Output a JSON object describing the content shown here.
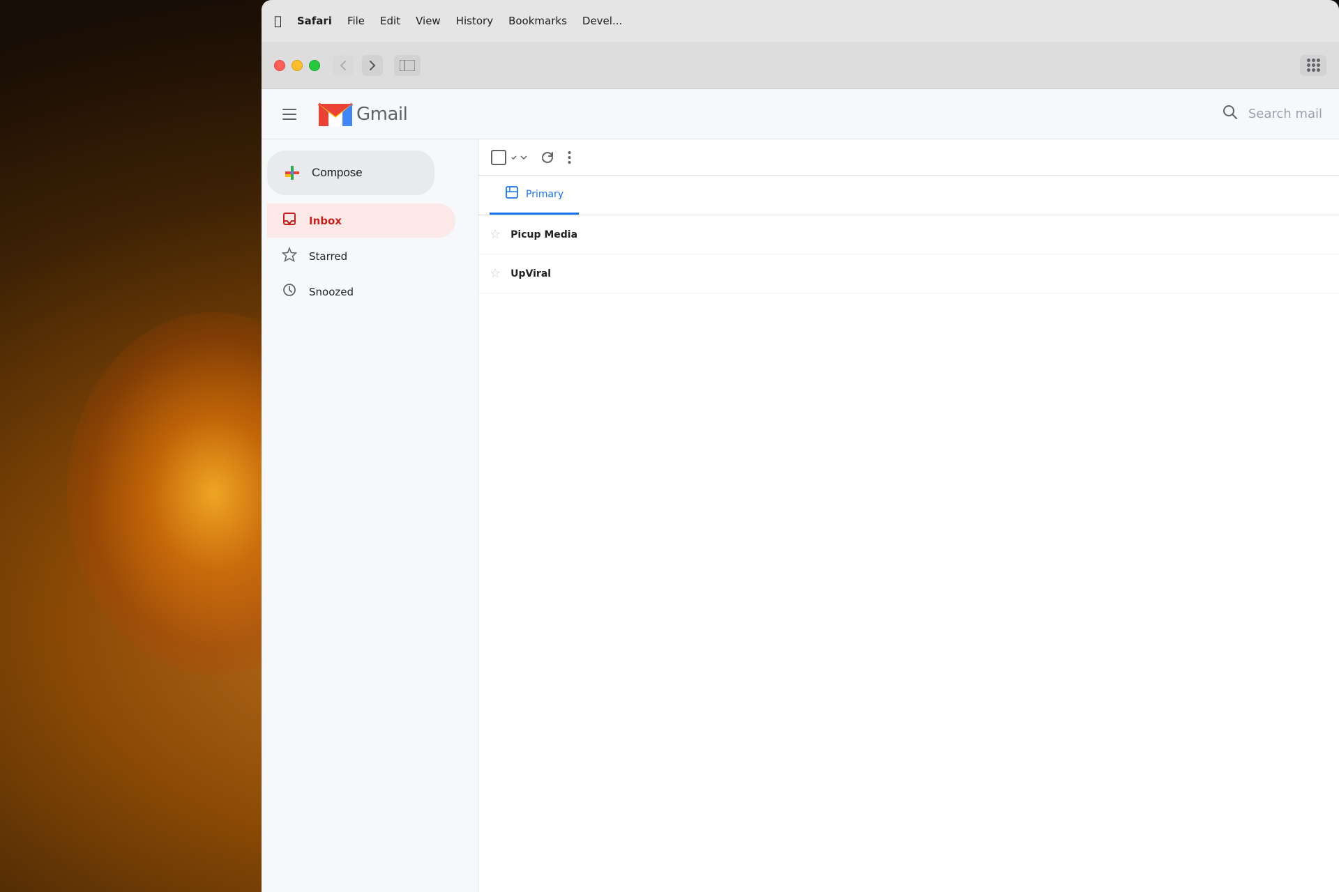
{
  "background": {
    "color": "#1a1008"
  },
  "menubar": {
    "apple_icon": "🍎",
    "items": [
      {
        "label": "Safari",
        "bold": true
      },
      {
        "label": "File",
        "bold": false
      },
      {
        "label": "Edit",
        "bold": false
      },
      {
        "label": "View",
        "bold": false
      },
      {
        "label": "History",
        "bold": false
      },
      {
        "label": "Bookmarks",
        "bold": false
      },
      {
        "label": "Devel...",
        "bold": false
      }
    ]
  },
  "browser": {
    "back_btn": "‹",
    "forward_btn": "›",
    "sidebar_icon": "⊟"
  },
  "gmail": {
    "title": "Gmail",
    "search_placeholder": "Search mail",
    "compose_label": "Compose",
    "nav_items": [
      {
        "id": "inbox",
        "label": "Inbox",
        "active": true,
        "icon": "bookmark"
      },
      {
        "id": "starred",
        "label": "Starred",
        "active": false,
        "icon": "star"
      },
      {
        "id": "snoozed",
        "label": "Snoozed",
        "active": false,
        "icon": "clock"
      }
    ],
    "tabs": [
      {
        "id": "primary",
        "label": "Primary",
        "active": true
      }
    ],
    "email_rows": [
      {
        "sender": "Picup Media",
        "star": false
      },
      {
        "sender": "UpViral",
        "star": false
      }
    ]
  }
}
